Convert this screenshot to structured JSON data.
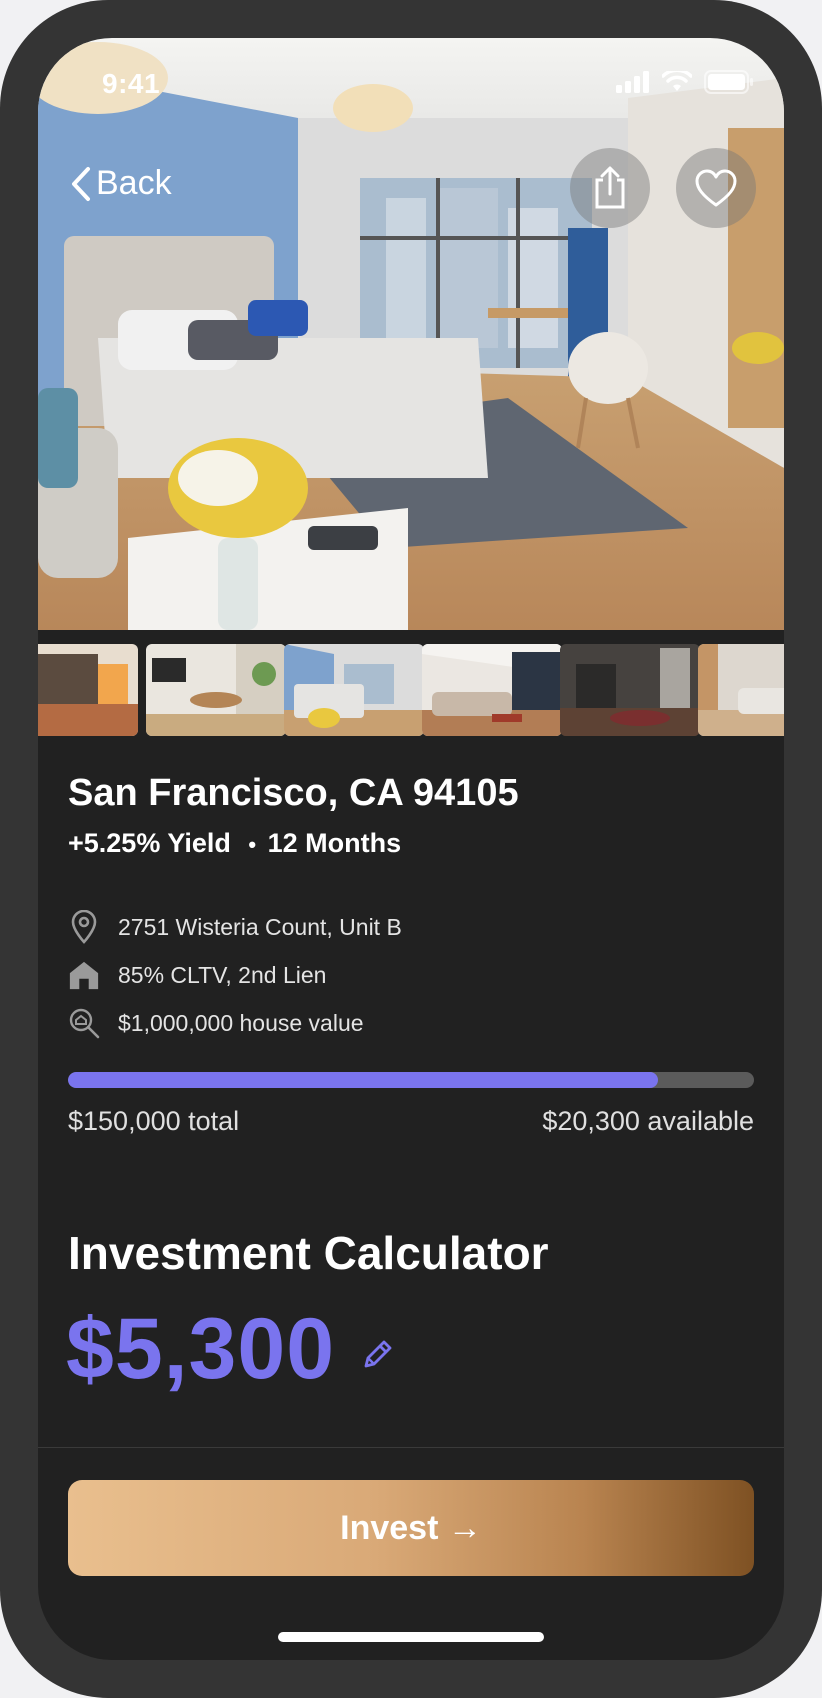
{
  "status_bar": {
    "time": "9:41"
  },
  "nav": {
    "back_label": "Back",
    "back_icon": "chevron-left-icon",
    "share_icon": "share-icon",
    "favorite_icon": "heart-icon"
  },
  "listing": {
    "title": "San Francisco, CA 94105",
    "yield": "+5.25% Yield",
    "separator": "•",
    "term": "12 Months",
    "address": "2751 Wisteria Count, Unit B",
    "lien": "85% CLTV, 2nd Lien",
    "house_value": "$1,000,000 house value",
    "funding_progress": 0.86,
    "total": "$150,000 total",
    "available": "$20,300 available"
  },
  "calculator": {
    "title": "Investment Calculator",
    "amount": "$5,300",
    "edit_icon": "pencil-icon"
  },
  "cta": {
    "label": "Invest →"
  },
  "colors": {
    "accent": "#7a74ee",
    "background": "#212121",
    "device_frame": "#343434",
    "cta_gradient_start": "#e9bf8e",
    "cta_gradient_end": "#7e5123"
  }
}
